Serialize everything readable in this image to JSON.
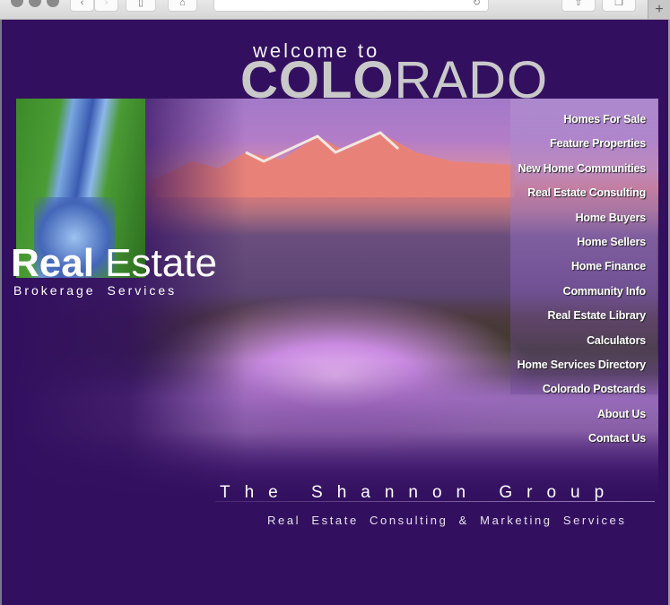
{
  "browser": {
    "back_icon": "‹",
    "forward_icon": "›",
    "sidebar_icon": "▯",
    "home_icon": "⌂",
    "reload_icon": "↻",
    "share_icon": "⇧",
    "tabs_icon": "❐",
    "new_tab_icon": "+"
  },
  "header": {
    "welcome": "welcome to",
    "state_bold": "COLO",
    "state_light": "RADO"
  },
  "brand": {
    "real_bold": "Real",
    "estate_light": " Estate",
    "tagline": "Brokerage  Services"
  },
  "nav": {
    "items": [
      {
        "label": "Homes For Sale"
      },
      {
        "label": "Feature Properties"
      },
      {
        "label": "New Home Communities"
      },
      {
        "label": "Real Estate Consulting"
      },
      {
        "label": "Home Buyers"
      },
      {
        "label": "Home Sellers"
      },
      {
        "label": "Home Finance"
      },
      {
        "label": "Community Info"
      },
      {
        "label": "Real Estate Library"
      },
      {
        "label": "Calculators"
      },
      {
        "label": "Home Services Directory"
      },
      {
        "label": "Colorado Postcards"
      },
      {
        "label": "About Us"
      },
      {
        "label": "Contact Us"
      }
    ]
  },
  "footer": {
    "company": "The  Shannon  Group",
    "services": "Real Estate Consulting & Marketing Services"
  },
  "colors": {
    "background": "#33105f",
    "nav_text": "#ffffff",
    "logo_gray": "#c9c9c9"
  }
}
